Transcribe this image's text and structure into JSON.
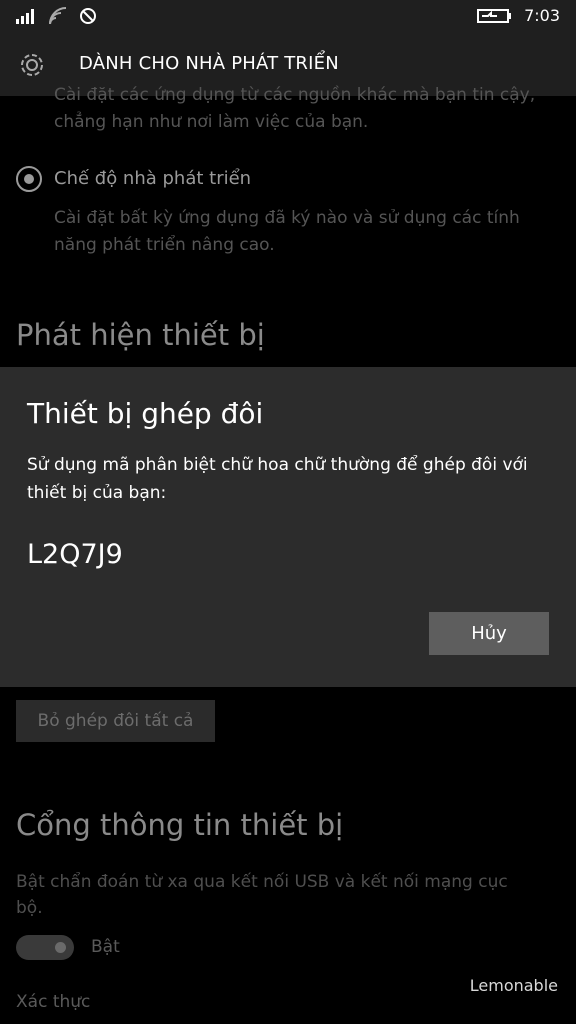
{
  "status_bar": {
    "time": "7:03",
    "icons": [
      "signal-icon",
      "wifi-icon",
      "sync-icon",
      "battery-charging-icon"
    ]
  },
  "header": {
    "title": "DÀNH CHO NHÀ PHÁT TRIỂN",
    "icon": "gear-icon"
  },
  "settings": {
    "sideload_desc_partial": "Cài đặt các ứng dụng từ các nguồn khác mà bạn tin cậy, chẳng hạn như nơi làm việc của bạn.",
    "developer_mode_label": "Chế độ nhà phát triển",
    "developer_mode_desc": "Cài đặt bất kỳ ứng dụng đã ký nào và sử dụng các tính năng phát triển nâng cao.",
    "discovery_title": "Phát hiện thiết bị",
    "unpair_all_label": "Bỏ ghép đôi tất cả",
    "portal_title": "Cổng thông tin thiết bị",
    "portal_desc": "Bật chẩn đoán từ xa qua kết nối USB và kết nối mạng cục bộ.",
    "portal_toggle_label": "Bật",
    "portal_toggle_on": true,
    "auth_label": "Xác thực"
  },
  "dialog": {
    "title": "Thiết bị ghép đôi",
    "body": "Sử dụng mã phân biệt chữ hoa chữ thường để ghép đôi với thiết bị của bạn:",
    "code": "L2Q7J9",
    "cancel_label": "Hủy"
  },
  "watermark": "Lemonable",
  "colors": {
    "background": "#000000",
    "header": "#1f1f1f",
    "dialog": "#2c2c2c",
    "button": "#5e5e5e"
  }
}
